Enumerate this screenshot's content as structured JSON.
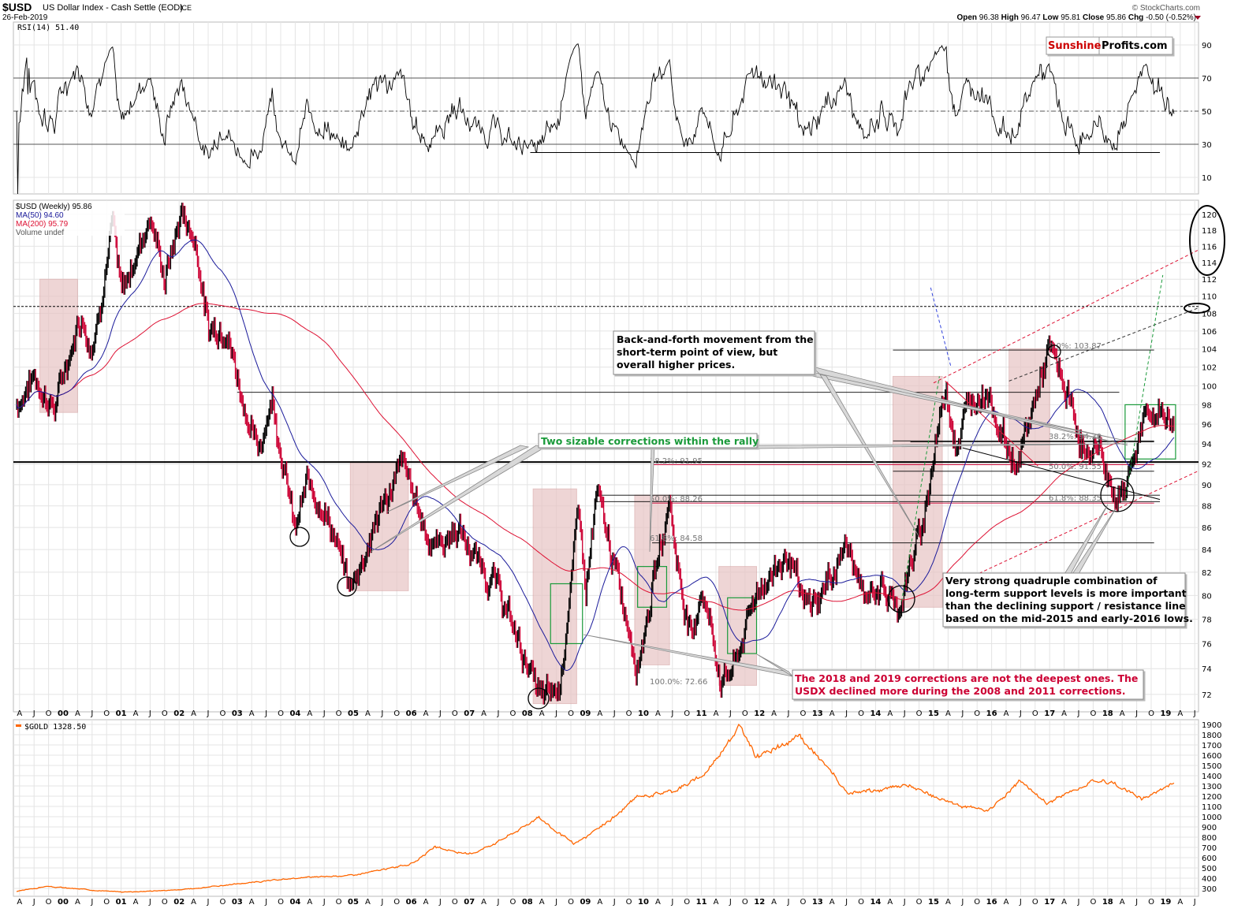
{
  "header": {
    "symbol": "$USD",
    "name": "US Dollar Index - Cash Settle (EOD)",
    "exchange": "ICE",
    "date": "26-Feb-2019",
    "copyright": "© StockCharts.com",
    "ohlc": {
      "open_label": "Open",
      "open": "96.38",
      "high_label": "High",
      "high": "96.47",
      "low_label": "Low",
      "low": "95.81",
      "close_label": "Close",
      "close": "95.86",
      "chg_label": "Chg",
      "chg": "-0.50 (-0.52%)"
    }
  },
  "watermark": {
    "part1": "Sunshine",
    "part2": "Profits.com"
  },
  "colors": {
    "up": "#000000",
    "down": "#cc0033",
    "ma50": "#1a1a9a",
    "ma200": "#dd1133",
    "gold": "#ff6600",
    "shade": "#e8c4c4",
    "green": "#1a9a3a",
    "annot_red": "#cc0033"
  },
  "rsi_panel": {
    "label": "RSI(14) 51.40",
    "y_ticks": [
      90,
      70,
      50,
      30,
      10
    ]
  },
  "main_panel": {
    "legend": [
      "$USD (Weekly) 95.86",
      "MA(50) 94.60",
      "MA(200) 95.79",
      "Volume undef"
    ],
    "y_ticks": [
      120,
      118,
      116,
      114,
      112,
      110,
      108,
      106,
      104,
      102,
      100,
      98,
      96,
      94,
      92,
      90,
      88,
      86,
      84,
      82,
      80,
      78,
      76,
      74,
      72
    ],
    "fib_left": [
      "38.2%: 91.95",
      "50.0%: 88.26",
      "61.8%: 84.58",
      "100.0%: 72.66"
    ],
    "fib_right": [
      "0.0%: 103.87",
      "38.2%: 94.30",
      "50.0%: 91.55",
      "61.8%: 88.35"
    ],
    "annotations": {
      "back_forth": [
        "Back-and-forth movement from the",
        "short-term point of view, but",
        "overall higher prices."
      ],
      "two_corrections": "Two sizable corrections within the rally",
      "quadruple": [
        "Very strong quadruple combination of",
        "long-term support levels is more important",
        "than the declining support / resistance line",
        "based on the mid-2015 and early-2016 lows."
      ],
      "deepest": [
        "The 2018 and 2019 corrections are not the deepest ones. The",
        "USDX declined more during the 2008 and 2011 corrections."
      ]
    }
  },
  "gold_panel": {
    "legend": "$GOLD 1328.50",
    "y_ticks": [
      1900,
      1800,
      1700,
      1600,
      1500,
      1400,
      1300,
      1200,
      1100,
      1000,
      900,
      800,
      700,
      600,
      500,
      400,
      300
    ]
  },
  "x_axis": {
    "years": [
      "00",
      "01",
      "02",
      "03",
      "04",
      "05",
      "06",
      "07",
      "08",
      "09",
      "10",
      "11",
      "12",
      "13",
      "14",
      "15",
      "16",
      "17",
      "18",
      "19"
    ],
    "months": [
      "A",
      "J",
      "O"
    ]
  },
  "chart_data": [
    {
      "type": "line",
      "title": "$USD (Weekly) approx. key closes",
      "x_unit": "year",
      "ylim": [
        71,
        121
      ],
      "scale": "log",
      "x": [
        1999.2,
        1999.5,
        1999.85,
        2000.0,
        2000.3,
        2000.5,
        2000.85,
        2001.0,
        2001.5,
        2001.75,
        2002.05,
        2002.3,
        2002.5,
        2002.8,
        2003.0,
        2003.35,
        2003.6,
        2004.0,
        2004.2,
        2004.5,
        2004.95,
        2005.5,
        2005.85,
        2006.3,
        2006.5,
        2006.8,
        2007.0,
        2007.5,
        2007.9,
        2008.25,
        2008.55,
        2008.9,
        2009.0,
        2009.2,
        2009.9,
        2010.45,
        2010.6,
        2010.85,
        2011.0,
        2011.35,
        2011.6,
        2011.95,
        2012.5,
        2012.75,
        2013.0,
        2013.5,
        2013.8,
        2014.0,
        2014.4,
        2014.8,
        2015.2,
        2015.4,
        2015.6,
        2015.9,
        2016.3,
        2016.45,
        2016.9,
        2017.0,
        2017.3,
        2017.7,
        2017.8,
        2018.1,
        2018.3,
        2018.6,
        2018.9,
        2019.15
      ],
      "y": [
        98,
        101,
        97.5,
        101,
        108,
        104,
        119,
        110,
        120,
        112,
        120.5,
        116,
        106,
        107,
        101,
        93,
        99,
        85.5,
        90,
        88,
        80.5,
        88,
        92,
        85,
        84.5,
        86,
        84,
        80.5,
        75.5,
        71.5,
        72.5,
        88,
        80,
        89,
        74.5,
        88.5,
        82,
        76,
        81,
        73,
        74.5,
        80.5,
        83.5,
        79,
        79.5,
        84.5,
        79.5,
        81,
        79,
        86,
        100,
        94,
        98,
        100,
        93,
        92,
        102,
        103.8,
        99,
        91.5,
        95,
        88.5,
        90,
        96,
        97.5,
        95.86
      ]
    },
    {
      "type": "line",
      "title": "$GOLD approx. key closes",
      "x_unit": "year",
      "ylim": [
        250,
        1950
      ],
      "x": [
        1999.2,
        1999.7,
        2001.0,
        2002.0,
        2003.0,
        2004.0,
        2005.0,
        2006.0,
        2006.4,
        2007.0,
        2008.2,
        2008.8,
        2009.9,
        2010.5,
        2011.0,
        2011.65,
        2011.95,
        2012.7,
        2013.3,
        2013.5,
        2014.0,
        2014.5,
        2015.0,
        2015.9,
        2016.5,
        2016.95,
        2017.7,
        2018.0,
        2018.65,
        2019.15
      ],
      "y": [
        270,
        320,
        265,
        285,
        345,
        400,
        430,
        540,
        700,
        630,
        1000,
        730,
        1200,
        1250,
        1390,
        1890,
        1580,
        1780,
        1400,
        1220,
        1250,
        1320,
        1200,
        1050,
        1360,
        1130,
        1350,
        1340,
        1180,
        1328.5
      ]
    }
  ]
}
